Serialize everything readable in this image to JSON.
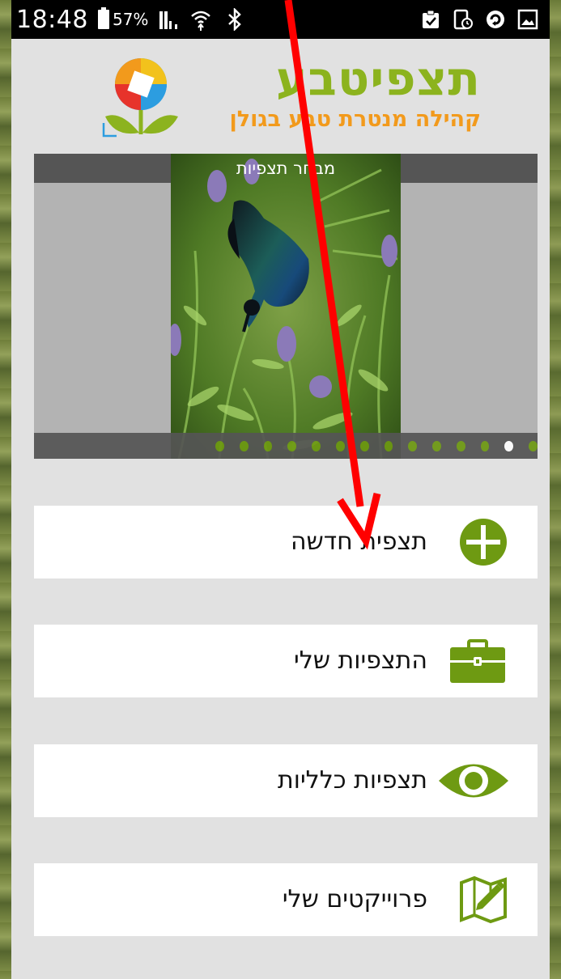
{
  "status_bar": {
    "time": "18:48",
    "battery_percent": "57%"
  },
  "logo": {
    "title": "תצפיטבע",
    "subtitle": "קהילה מנטרת טבע בגולן"
  },
  "carousel": {
    "title": "מבחר תצפיות",
    "total_slides": 14,
    "active_index": 12
  },
  "menu": [
    {
      "label": "תצפית חדשה",
      "icon": "plus-circle-icon"
    },
    {
      "label": "התצפיות שלי",
      "icon": "briefcase-icon"
    },
    {
      "label": "תצפיות כלליות",
      "icon": "eye-icon"
    },
    {
      "label": "פרוייקטים שלי",
      "icon": "map-pencil-icon"
    }
  ],
  "colors": {
    "accent_green": "#6e9a12",
    "logo_green": "#8cb31e",
    "logo_orange": "#f29a1c",
    "annotation_red": "#ff0000"
  }
}
